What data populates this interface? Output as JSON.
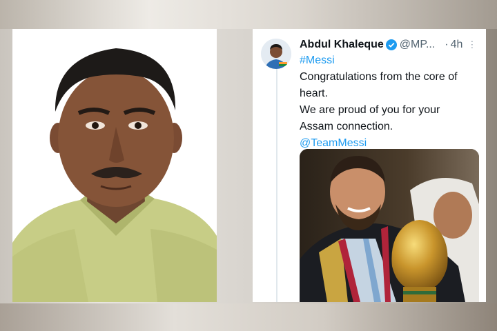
{
  "tweet": {
    "author_name": "Abdul Khaleque",
    "handle": "@MP...",
    "separator": "·",
    "time": "4h",
    "more": "⋮",
    "lines": [
      "#Messi",
      "Congratulations from the core of",
      "heart.",
      "We are proud of you for your",
      "Assam connection.",
      "@TeamMessi"
    ],
    "hashtag_color": "#1d9bf0",
    "verified_color": "#1d9bf0"
  },
  "icons": {
    "verified": "verified-badge-icon",
    "more": "more-options-icon"
  },
  "colors": {
    "text": "#0f1419",
    "muted": "#536471",
    "shirt": "#c9cf86"
  }
}
